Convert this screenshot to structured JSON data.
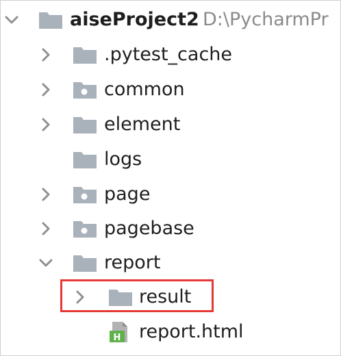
{
  "project": {
    "name": "aiseProject2",
    "path": "D:\\PycharmPr"
  },
  "tree": {
    "items": [
      {
        "label": ".pytest_cache",
        "kind": "folder",
        "expanded": false
      },
      {
        "label": "common",
        "kind": "package-folder",
        "expanded": false
      },
      {
        "label": "element",
        "kind": "folder",
        "expanded": false
      },
      {
        "label": "logs",
        "kind": "folder",
        "expanded": null
      },
      {
        "label": "page",
        "kind": "package-folder",
        "expanded": false
      },
      {
        "label": "pagebase",
        "kind": "package-folder",
        "expanded": false
      },
      {
        "label": "report",
        "kind": "folder",
        "expanded": true
      },
      {
        "label": "result",
        "kind": "folder",
        "expanded": false
      },
      {
        "label": "report.html",
        "kind": "html-file",
        "expanded": null
      }
    ]
  },
  "colors": {
    "folder": "#a9b1ba",
    "text": "#1e1e1e",
    "path_text": "#8a8a8a",
    "highlight_border": "#e53935",
    "html_badge": "#5fb14a"
  }
}
